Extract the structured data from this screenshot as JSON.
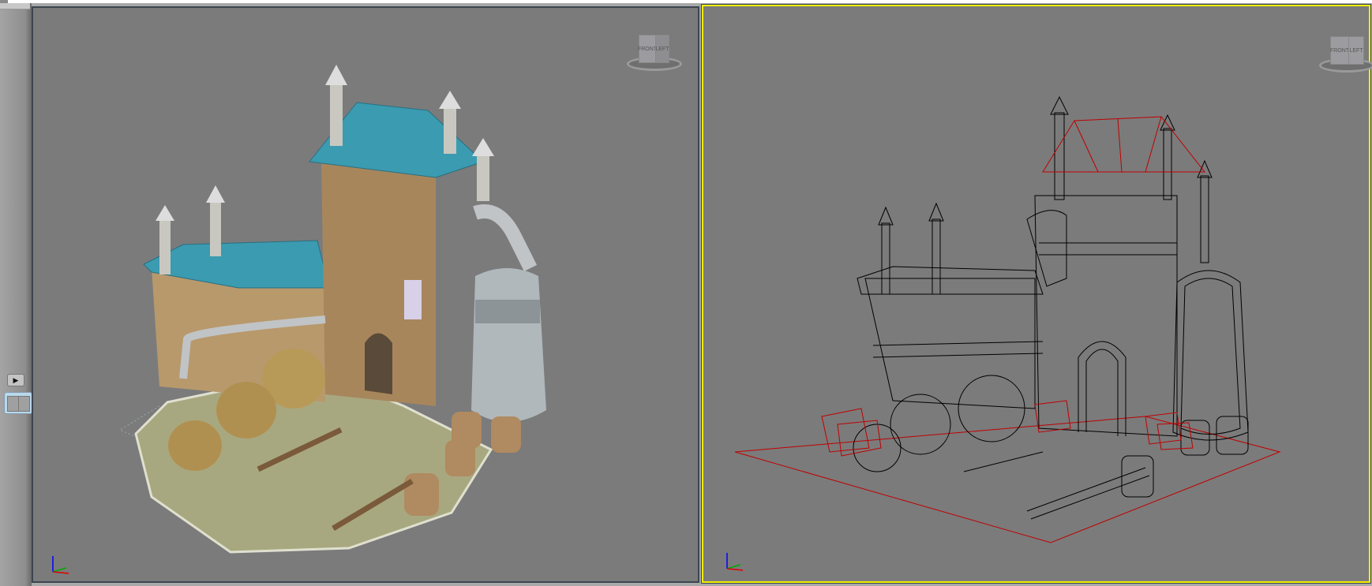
{
  "app": {
    "type": "3D viewport editor"
  },
  "sidebar": {
    "play_icon": "play-triangle",
    "layout_icon": "two-viewport-layout"
  },
  "viewports": [
    {
      "id": "left",
      "mode": "shaded",
      "active": false,
      "viewcube": {
        "front": "FRONT",
        "side": "LEFT"
      }
    },
    {
      "id": "right",
      "mode": "wireframe",
      "active": true,
      "viewcube": {
        "front": "FRONT",
        "side": "LEFT"
      }
    }
  ],
  "colors": {
    "viewport_bg": "#7b7b7b",
    "active_border": "#f5f000",
    "wire_black": "#000000",
    "wire_selected": "#c00000",
    "roof": "#3b9bb0",
    "wall": "#b89a70"
  }
}
